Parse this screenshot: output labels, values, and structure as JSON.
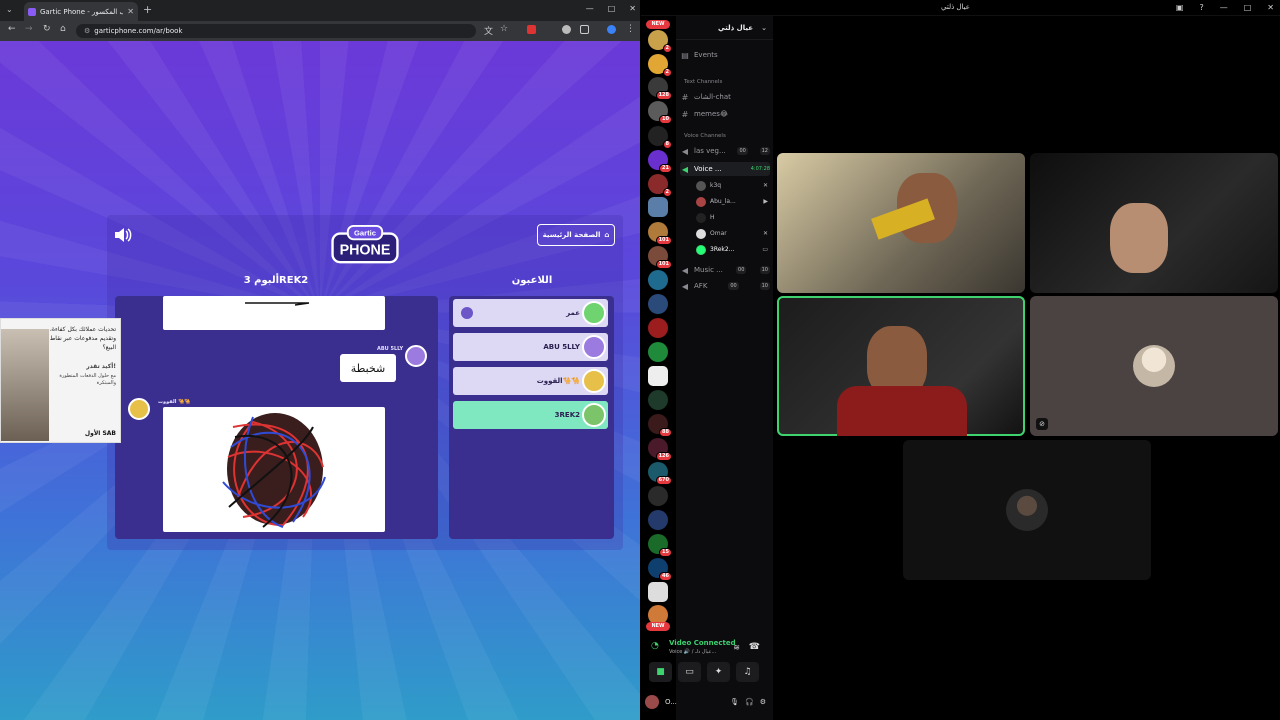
{
  "browser": {
    "tab_title": "Gartic Phone - الهاتف المكسور",
    "url": "garticphone.com/ar/book",
    "window_controls": [
      "—",
      "□",
      "✕"
    ]
  },
  "game": {
    "home_button": "الصفحة الرئيسية",
    "logo_line1": "Gartic",
    "logo_line2": "PHONE",
    "players_title": "اللاعبون",
    "album_title": "ألبوم 3REK2",
    "players": [
      {
        "name": "عمر",
        "crown": true,
        "active": false
      },
      {
        "name": "ABU 5LLY",
        "crown": false,
        "active": false
      },
      {
        "name": "القووت🐪🐪",
        "crown": false,
        "active": false
      },
      {
        "name": "3REK2",
        "crown": false,
        "active": true
      }
    ],
    "album": {
      "author1": "ABU 5LLY",
      "guess_text": "شخبطة",
      "author2": "القووت 🐪🐪"
    }
  },
  "ad": {
    "headline": "تحديات عملائك بكل كفاءة، وتقديم مدفوعات عبر نقاط البيع؟",
    "sub": "أكيد تقدر!",
    "sub2": "مع حلول الدفعات المتطورة والمبتكرة",
    "brand": "الأول SAB"
  },
  "discord": {
    "window_title": "عيال ذلتي",
    "guild_name": "عيال ذلتي",
    "events": "Events",
    "text_category": "Text Channels",
    "voice_category": "Voice Channels",
    "text_channels": [
      "الشات-chat",
      "memes😂"
    ],
    "voice_channels": [
      {
        "name": "las veg...",
        "pills": [
          "00",
          "12"
        ]
      },
      {
        "name": "Voice ...",
        "time": "4:07:28",
        "active": true
      },
      {
        "name": "Music ...",
        "pills": [
          "00",
          "10"
        ]
      },
      {
        "name": "AFK",
        "pills": [
          "00",
          "10"
        ]
      }
    ],
    "members": [
      "k3q",
      "Abu_la...",
      "H",
      "Omar",
      "3Rek2..."
    ],
    "server_badges": [
      "2",
      "2",
      "128",
      "10",
      "8",
      "21",
      "2",
      "101",
      "101",
      "88",
      "126",
      "670",
      "15",
      "46"
    ],
    "new_label": "NEW",
    "video_connected": "Video Connected",
    "voice_sub": "Voice 🔊 / عيال ذلـ...",
    "user_name": "O...",
    "colors": {
      "speaking": "#3fd36f",
      "badge": "#e5393f"
    }
  }
}
